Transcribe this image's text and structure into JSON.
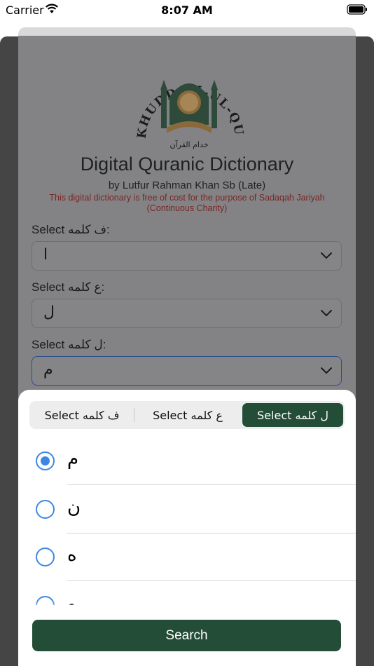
{
  "status_bar": {
    "carrier": "Carrier",
    "time": "8:07 AM"
  },
  "header": {
    "logo_text": "KHUDDAM-UL-QURAN UK",
    "logo_arabic": "خدام القرآن",
    "title": "Digital Quranic Dictionary",
    "author": "by Lutfur Rahman Khan Sb (Late)",
    "notice": "This digital dictionary is free of cost for the purpose of Sadaqah Jariyah (Continuous Charity)"
  },
  "form": {
    "fields": [
      {
        "label": "Select ف کلمه:",
        "value": "ا"
      },
      {
        "label": "Select ع کلمه:",
        "value": "ل"
      },
      {
        "label": "Select ل کلمه:",
        "value": "م"
      }
    ]
  },
  "sheet": {
    "segments": [
      "Select ف کلمه",
      "Select ع کلمه",
      "Select ل کلمه"
    ],
    "active_segment": 2,
    "options": [
      {
        "label": "م",
        "selected": true
      },
      {
        "label": "ن",
        "selected": false
      },
      {
        "label": "ه",
        "selected": false
      },
      {
        "label": "و",
        "selected": false
      }
    ],
    "search_label": "Search"
  },
  "colors": {
    "accent": "#244d37",
    "radio": "#3b88e4",
    "notice": "#7a2626"
  },
  "icons": [
    "wifi-icon",
    "battery-icon",
    "chevron-down-icon",
    "radio-icon"
  ]
}
